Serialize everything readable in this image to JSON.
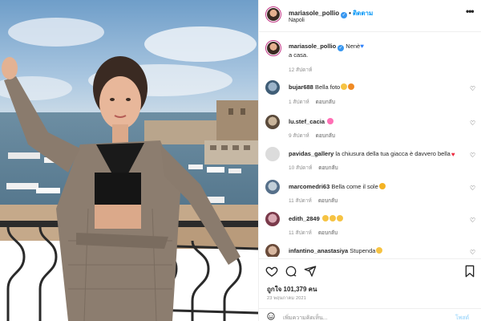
{
  "post": {
    "username": "mariasole_pollio",
    "follow_label": "ติดตาม",
    "location": "Napoli",
    "caption_text": "Nenè",
    "caption_line2": "a casa.",
    "caption_age": "12 สัปดาห์"
  },
  "comments": [
    {
      "user": "bujar688",
      "text": "Bella foto",
      "age": "1 สัปดาห์",
      "reply": "ตอบกลับ"
    },
    {
      "user": "lu.stef_cacia",
      "text": "",
      "age": "9 สัปดาห์",
      "reply": "ตอบกลับ"
    },
    {
      "user": "pavidas_gallery",
      "text": "la chiusura della tua giacca è davvero bella",
      "age": "10 สัปดาห์",
      "reply": "ตอบกลับ"
    },
    {
      "user": "marcomedri63",
      "text": "Bella come il sole",
      "age": "11 สัปดาห์",
      "reply": "ตอบกลับ"
    },
    {
      "user": "edith_2849",
      "text": "",
      "age": "11 สัปดาห์",
      "reply": "ตอบกลับ"
    },
    {
      "user": "infantino_anastasiya",
      "text": "Stupenda",
      "age": "",
      "reply": ""
    }
  ],
  "actions": {
    "likes": "ถูกใจ 101,379 คน",
    "date": "23 พฤษภาคม 2021"
  },
  "add_comment": {
    "placeholder": "เพิ่มความคิดเห็น...",
    "post_label": "โพสต์"
  },
  "icons": {
    "more": "more-horizontal-icon",
    "like": "heart-outline-icon",
    "comment": "comment-bubble-icon",
    "share": "paper-plane-icon",
    "save": "bookmark-icon",
    "emoji": "smiley-icon",
    "verified": "verified-badge-icon"
  },
  "colors": {
    "accent": "#0095f6",
    "verified": "#3897f0",
    "muted": "#8e8e8e",
    "border": "#efefef"
  }
}
